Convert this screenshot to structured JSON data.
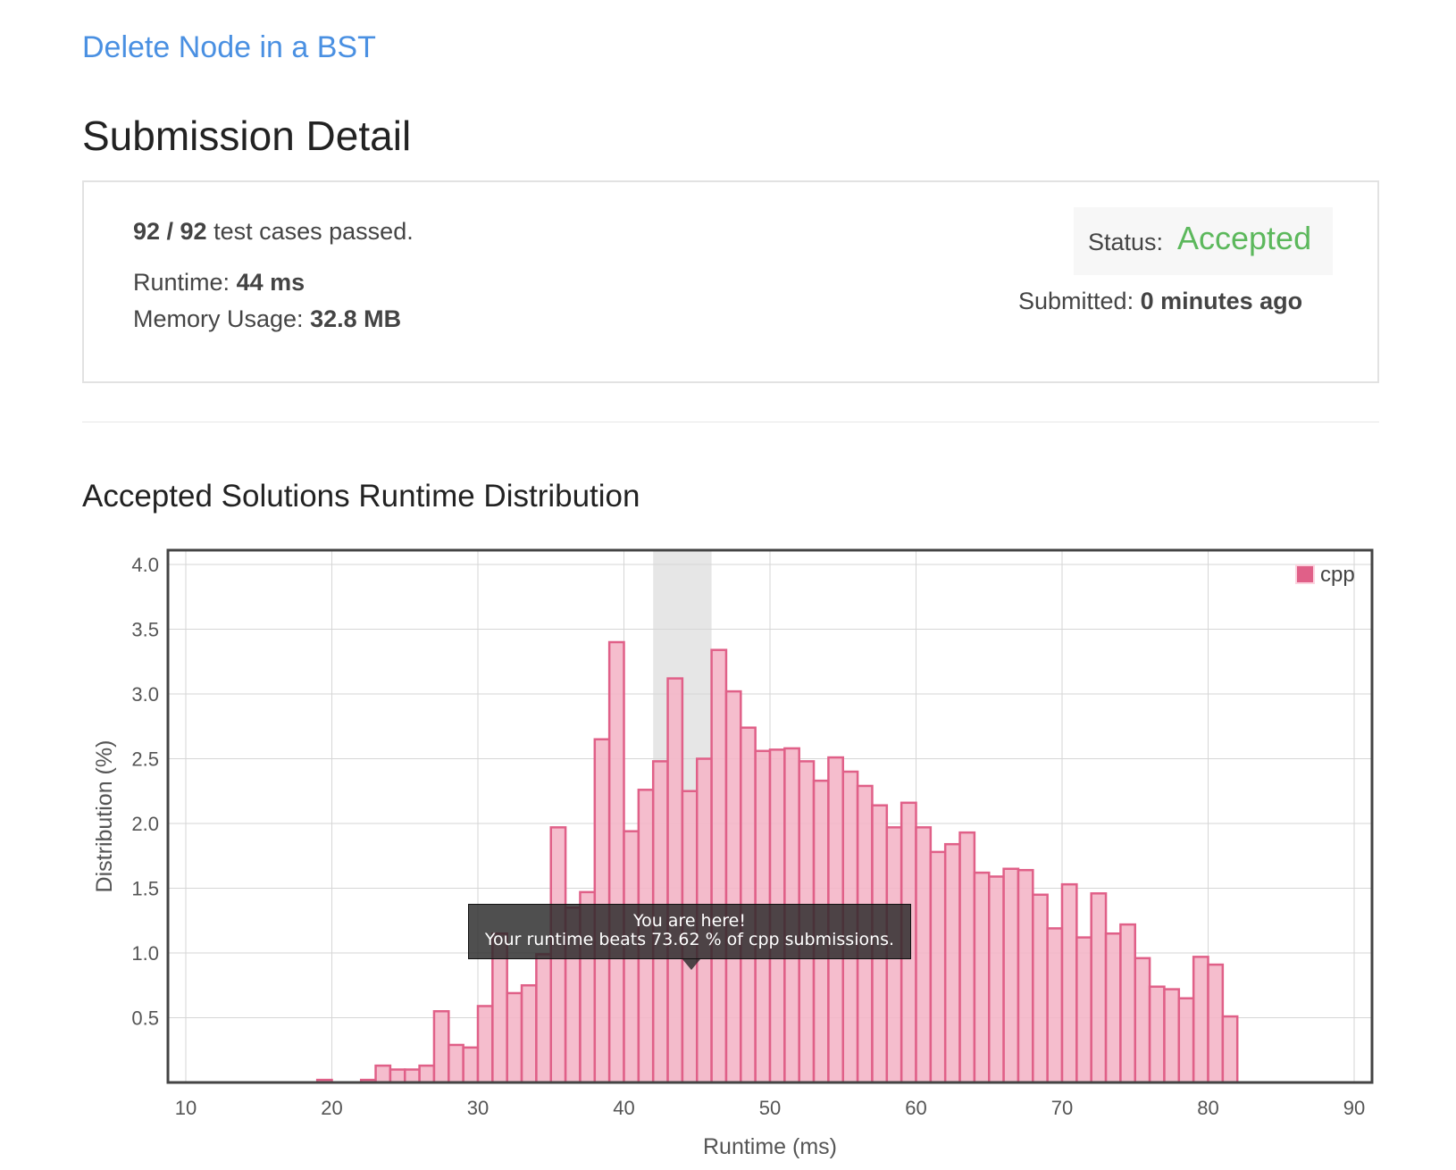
{
  "problem": {
    "title": "Delete Node in a BST"
  },
  "page": {
    "title": "Submission Detail"
  },
  "details": {
    "cases_passed": "92 / 92",
    "cases_suffix": "test cases passed.",
    "runtime_label": "Runtime:",
    "runtime_value": "44 ms",
    "memory_label": "Memory Usage:",
    "memory_value": "32.8 MB",
    "status_label": "Status:",
    "status_value": "Accepted",
    "submitted_label": "Submitted:",
    "submitted_value": "0 minutes ago"
  },
  "section": {
    "title": "Accepted Solutions Runtime Distribution"
  },
  "tooltip": {
    "line1": "You are here!",
    "line2": "Your runtime beats 73.62 % of cpp submissions."
  },
  "colors": {
    "accent": "#4a90e2",
    "accepted": "#5cb85c",
    "bar_fill": "#f4b6c8",
    "bar_stroke": "#e06088"
  },
  "chart_data": {
    "type": "bar",
    "xlabel": "Runtime (ms)",
    "ylabel": "Distribution (%)",
    "xlim": [
      10,
      90
    ],
    "ylim": [
      0,
      4.0
    ],
    "xticks": [
      "10",
      "20",
      "30",
      "40",
      "50",
      "60",
      "70",
      "80",
      "90"
    ],
    "yticks": [
      "0.5",
      "1.0",
      "1.5",
      "2.0",
      "2.5",
      "3.0",
      "3.5",
      "4.0"
    ],
    "grid": true,
    "legend_position": "top-right",
    "highlight_range": [
      42,
      46
    ],
    "bin_width": 1,
    "series": [
      {
        "name": "cpp",
        "x": [
          19,
          22,
          23,
          24,
          25,
          26,
          27,
          28,
          29,
          30,
          31,
          32,
          33,
          34,
          35,
          36,
          37,
          38,
          39,
          40,
          41,
          42,
          43,
          44,
          45,
          46,
          47,
          48,
          49,
          50,
          51,
          52,
          53,
          54,
          55,
          56,
          57,
          58,
          59,
          60,
          61,
          62,
          63,
          64,
          65,
          66,
          67,
          68,
          69,
          70,
          71,
          72,
          73,
          74,
          75,
          76,
          77,
          78,
          79,
          80,
          81
        ],
        "values": [
          0.02,
          0.02,
          0.13,
          0.1,
          0.1,
          0.13,
          0.55,
          0.29,
          0.27,
          0.59,
          1.15,
          0.69,
          0.75,
          0.99,
          1.97,
          1.35,
          1.47,
          2.65,
          3.4,
          1.94,
          2.26,
          2.48,
          3.12,
          2.25,
          2.5,
          3.34,
          3.02,
          2.74,
          2.56,
          2.57,
          2.58,
          2.48,
          2.33,
          2.51,
          2.4,
          2.29,
          2.14,
          1.97,
          2.16,
          1.97,
          1.78,
          1.84,
          1.93,
          1.62,
          1.59,
          1.65,
          1.64,
          1.45,
          1.19,
          1.53,
          1.12,
          1.46,
          1.15,
          1.22,
          0.96,
          0.74,
          0.72,
          0.65,
          0.97,
          0.91,
          0.51
        ]
      }
    ]
  }
}
